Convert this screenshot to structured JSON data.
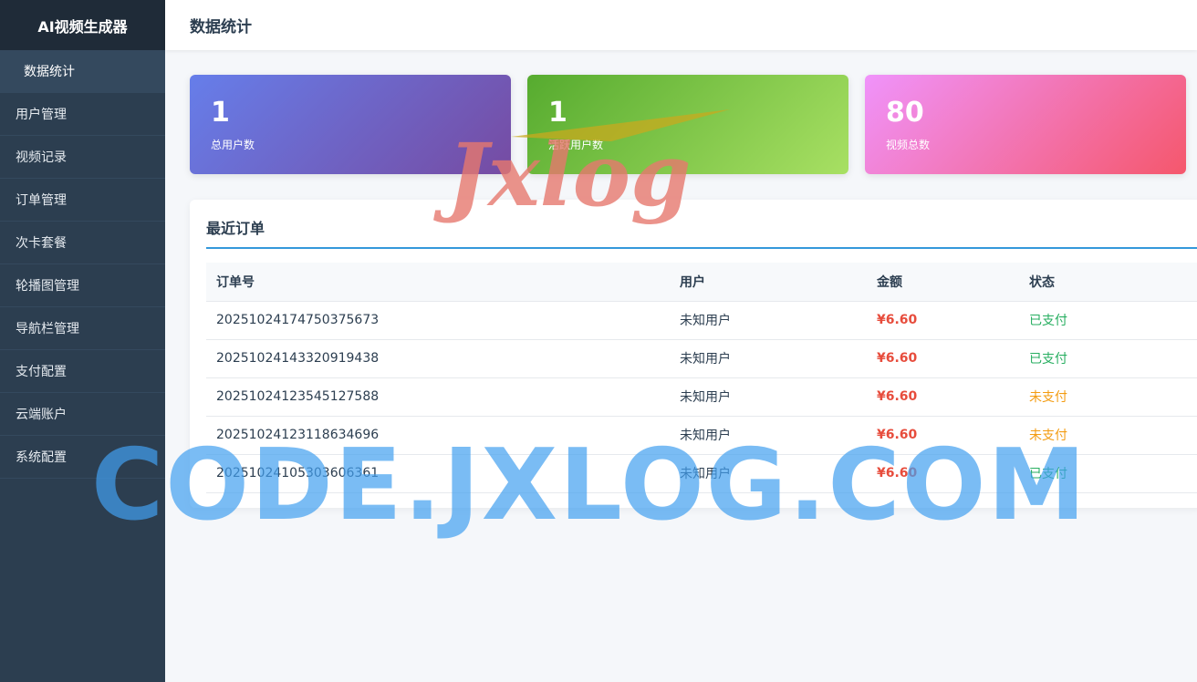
{
  "sidebar": {
    "brand": "AI视频生成器",
    "items": [
      {
        "label": "数据统计",
        "active": true
      },
      {
        "label": "用户管理"
      },
      {
        "label": "视频记录"
      },
      {
        "label": "订单管理"
      },
      {
        "label": "次卡套餐"
      },
      {
        "label": "轮播图管理"
      },
      {
        "label": "导航栏管理"
      },
      {
        "label": "支付配置"
      },
      {
        "label": "云端账户"
      },
      {
        "label": "系统配置"
      }
    ]
  },
  "header": {
    "title": "数据统计"
  },
  "stats": [
    {
      "value": "1",
      "label": "总用户数"
    },
    {
      "value": "1",
      "label": "活跃用户数"
    },
    {
      "value": "80",
      "label": "视频总数"
    }
  ],
  "orders": {
    "title": "最近订单",
    "columns": [
      "订单号",
      "用户",
      "金额",
      "状态"
    ],
    "rows": [
      {
        "id": "20251024174750375673",
        "user": "未知用户",
        "amount": "¥6.60",
        "status": "已支付"
      },
      {
        "id": "20251024143320919438",
        "user": "未知用户",
        "amount": "¥6.60",
        "status": "已支付"
      },
      {
        "id": "20251024123545127588",
        "user": "未知用户",
        "amount": "¥6.60",
        "status": "未支付"
      },
      {
        "id": "20251024123118634696",
        "user": "未知用户",
        "amount": "¥6.60",
        "status": "未支付"
      },
      {
        "id": "20251024105303606361",
        "user": "未知用户",
        "amount": "¥6.60",
        "status": "已支付"
      }
    ]
  },
  "watermark": {
    "logo_text": "Jxlog",
    "text": "CODE.JXLOG.COM"
  },
  "colors": {
    "sidebar_bg": "#2c3e50",
    "accent": "#3498db",
    "amount": "#e74c3c",
    "paid": "#27ae60",
    "unpaid": "#f39c12"
  }
}
